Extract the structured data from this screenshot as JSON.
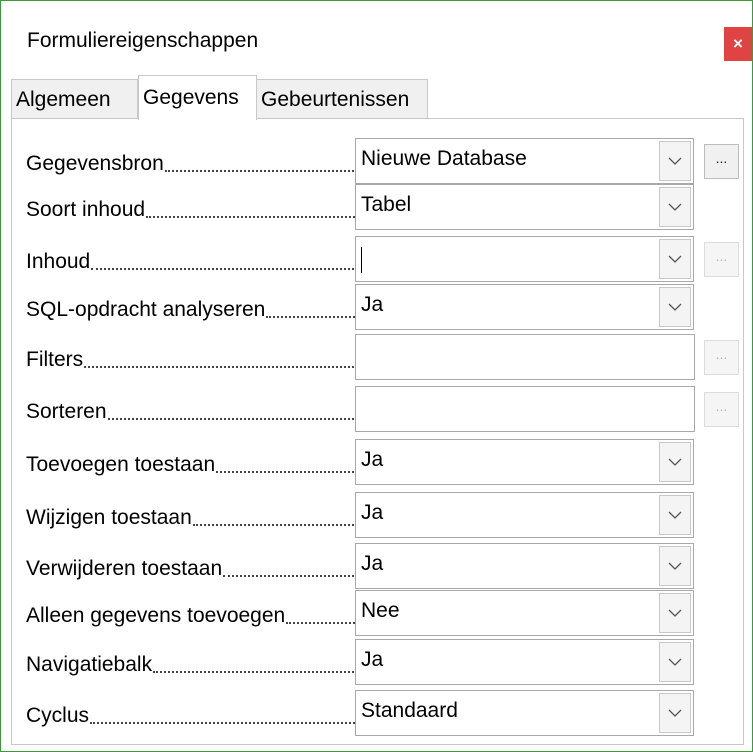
{
  "window": {
    "title": "Formuliereigenschappen",
    "close_glyph": "×"
  },
  "tabs": [
    {
      "label": "Algemeen",
      "active": false
    },
    {
      "label": "Gegevens",
      "active": true
    },
    {
      "label": "Gebeurtenissen",
      "active": false
    }
  ],
  "icons": {
    "dropdown": "chevron-down-icon",
    "more": "ellipsis-icon",
    "close": "close-icon"
  },
  "colors": {
    "close_button": "#e04343",
    "window_border": "#3c9a3c"
  },
  "rows": [
    {
      "label": "Gegevensbron",
      "value": "Nieuwe Database",
      "more": "..."
    },
    {
      "label": "Soort inhoud",
      "value": "Tabel"
    },
    {
      "label": "Inhoud",
      "value": "",
      "more": "..."
    },
    {
      "label": "SQL-opdracht analyseren",
      "value": "Ja"
    },
    {
      "label": "Filters",
      "value": "",
      "more": "..."
    },
    {
      "label": "Sorteren",
      "value": "",
      "more": "..."
    },
    {
      "label": "Toevoegen toestaan",
      "value": "Ja"
    },
    {
      "label": "Wijzigen toestaan",
      "value": "Ja"
    },
    {
      "label": "Verwijderen toestaan",
      "value": "Ja"
    },
    {
      "label": "Alleen gegevens toevoegen",
      "value": "Nee"
    },
    {
      "label": "Navigatiebalk",
      "value": "Ja"
    },
    {
      "label": "Cyclus",
      "value": "Standaard"
    }
  ]
}
